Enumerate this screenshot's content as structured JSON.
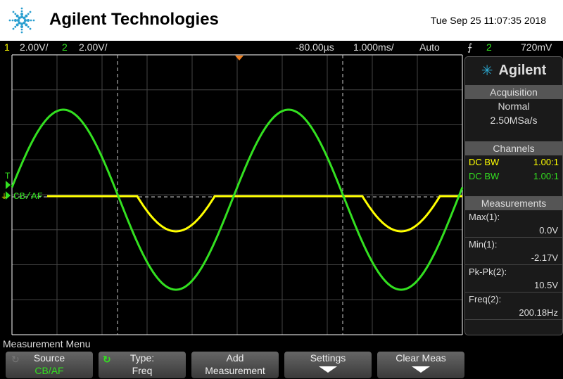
{
  "header": {
    "brand": "Agilent Technologies",
    "datetime": "Tue Sep 25 11:07:35 2018"
  },
  "status": {
    "ch1_num": "1",
    "ch1_scale": "2.00V/",
    "ch2_num": "2",
    "ch2_scale": "2.00V/",
    "delay": "-80.00µs",
    "timebase": "1.000ms/",
    "trigger_mode": "Auto",
    "trigger_source": "2",
    "trigger_level": "720mV"
  },
  "plot": {
    "trigger_marker": "T",
    "ground_label": "CB/AF",
    "colors": {
      "ch1": "#ffff00",
      "ch2": "#33e020"
    }
  },
  "side": {
    "brand": "Agilent",
    "acq_title": "Acquisition",
    "acq_mode": "Normal",
    "sample_rate": "2.50MSa/s",
    "channels_title": "Channels",
    "channels": [
      {
        "coupling": "DC BW",
        "probe": "1.00:1"
      },
      {
        "coupling": "DC BW",
        "probe": "1.00:1"
      }
    ],
    "meas_title": "Measurements",
    "measurements": [
      {
        "label": "Max(1):",
        "value": "0.0V"
      },
      {
        "label": "Min(1):",
        "value": "-2.17V"
      },
      {
        "label": "Pk-Pk(2):",
        "value": "10.5V"
      },
      {
        "label": "Freq(2):",
        "value": "200.18Hz"
      }
    ]
  },
  "menu": {
    "title": "Measurement Menu",
    "source_label": "Source",
    "source_value": "CB/AF",
    "type_label": "Type:",
    "type_value": "Freq",
    "add_l1": "Add",
    "add_l2": "Measurement",
    "settings": "Settings",
    "clear": "Clear Meas"
  }
}
